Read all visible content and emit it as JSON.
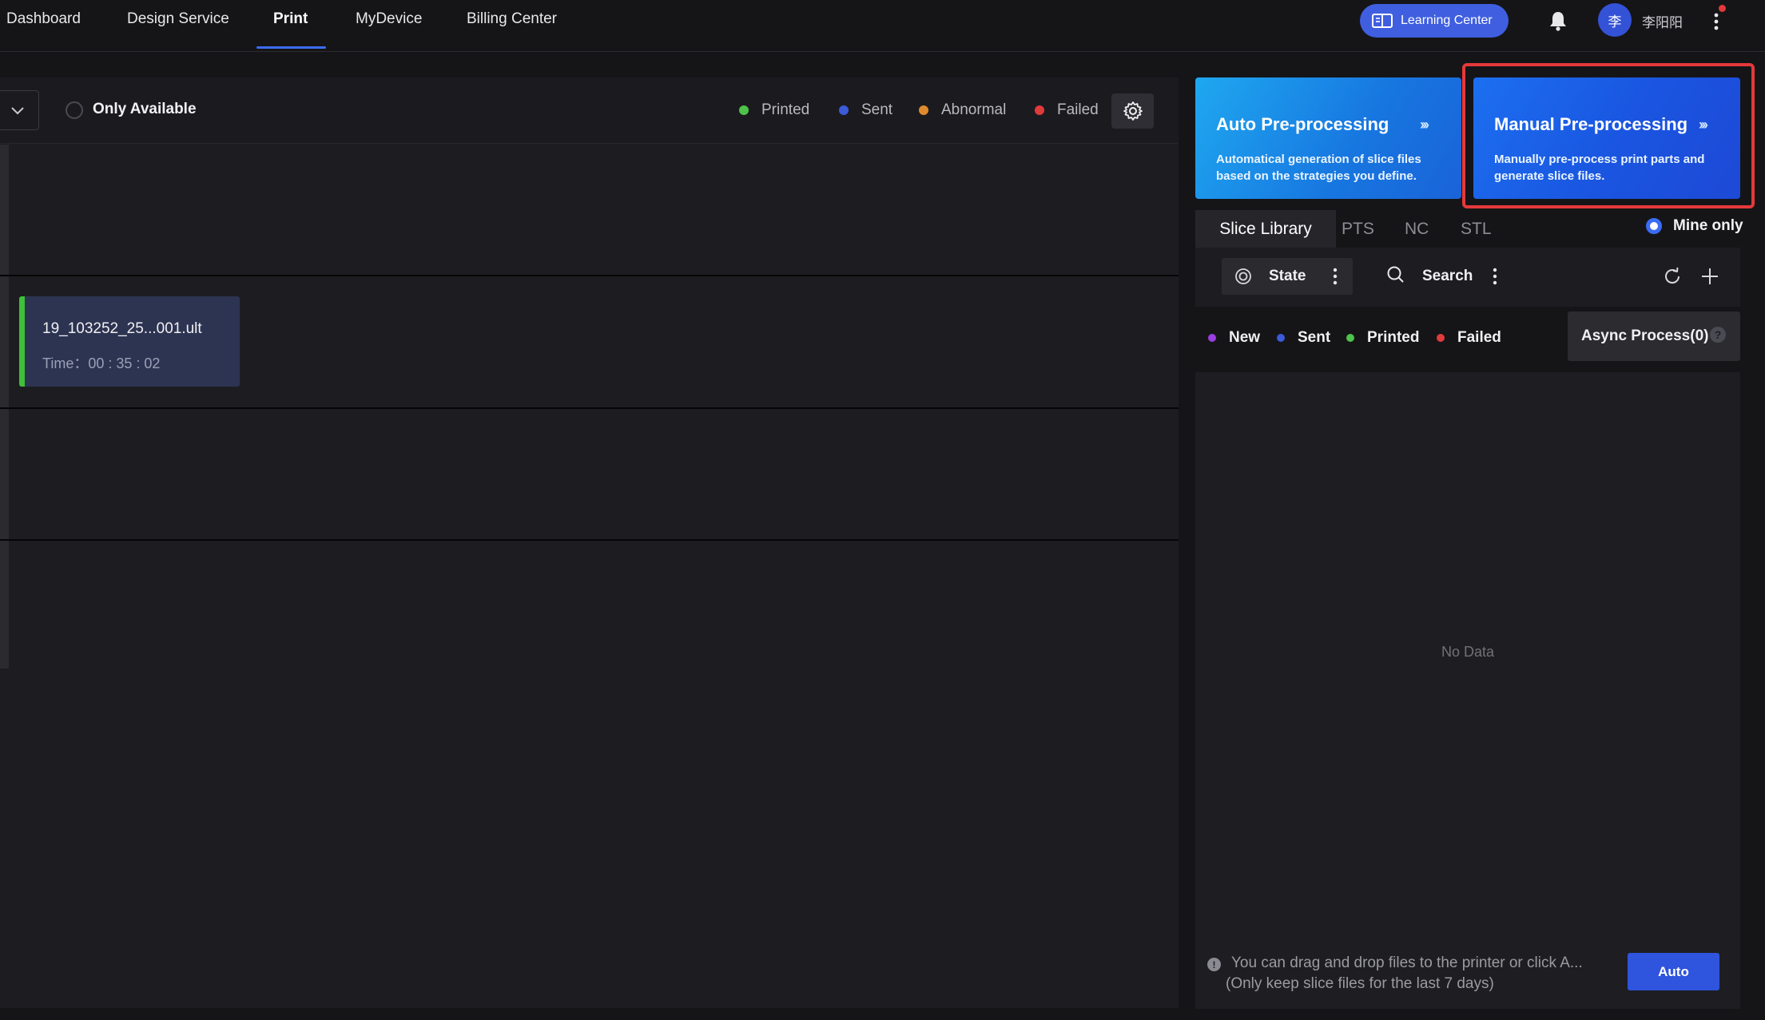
{
  "nav": {
    "items": [
      {
        "label": "Dashboard"
      },
      {
        "label": "Design Service"
      },
      {
        "label": "Print"
      },
      {
        "label": "MyDevice"
      },
      {
        "label": "Billing Center"
      }
    ],
    "active": "Print",
    "learning_center": "Learning Center",
    "avatar_initial": "李",
    "username": "李阳阳"
  },
  "toolbar": {
    "only_available": "Only Available",
    "legend": [
      {
        "label": "Printed",
        "color": "#4ec34a"
      },
      {
        "label": "Sent",
        "color": "#3b5bd9"
      },
      {
        "label": "Abnormal",
        "color": "#e08a2e"
      },
      {
        "label": "Failed",
        "color": "#e03b3b"
      }
    ]
  },
  "job": {
    "name": "19_103252_25...001.ult",
    "time": "Time：00 : 35 : 02",
    "status_color": "#3fbf3a"
  },
  "cards": {
    "auto": {
      "title": "Auto Pre-processing",
      "desc": "Automatical generation of slice files based on the strategies you define.",
      "arrows": "›››"
    },
    "manual": {
      "title": "Manual Pre-processing",
      "desc": "Manually pre-process print parts and generate slice files.",
      "arrows": "›››"
    }
  },
  "library": {
    "tabs": [
      "Slice Library",
      "PTS",
      "NC",
      "STL"
    ],
    "active_tab": "Slice Library",
    "mine_only": "Mine only",
    "state": "State",
    "search": "Search",
    "statuses": [
      {
        "label": "New",
        "color": "#9b3fe0"
      },
      {
        "label": "Sent",
        "color": "#3b5bd9"
      },
      {
        "label": "Printed",
        "color": "#4ec34a"
      },
      {
        "label": "Failed",
        "color": "#e03b3b"
      }
    ],
    "async": "Async Process(0)",
    "help": "?",
    "no_data": "No Data",
    "tip_line1": "You can drag and drop files to the printer or click A...",
    "tip_line2": "(Only keep slice files for the last 7 days)",
    "tip_icon": "!",
    "auto_button": "Auto"
  }
}
